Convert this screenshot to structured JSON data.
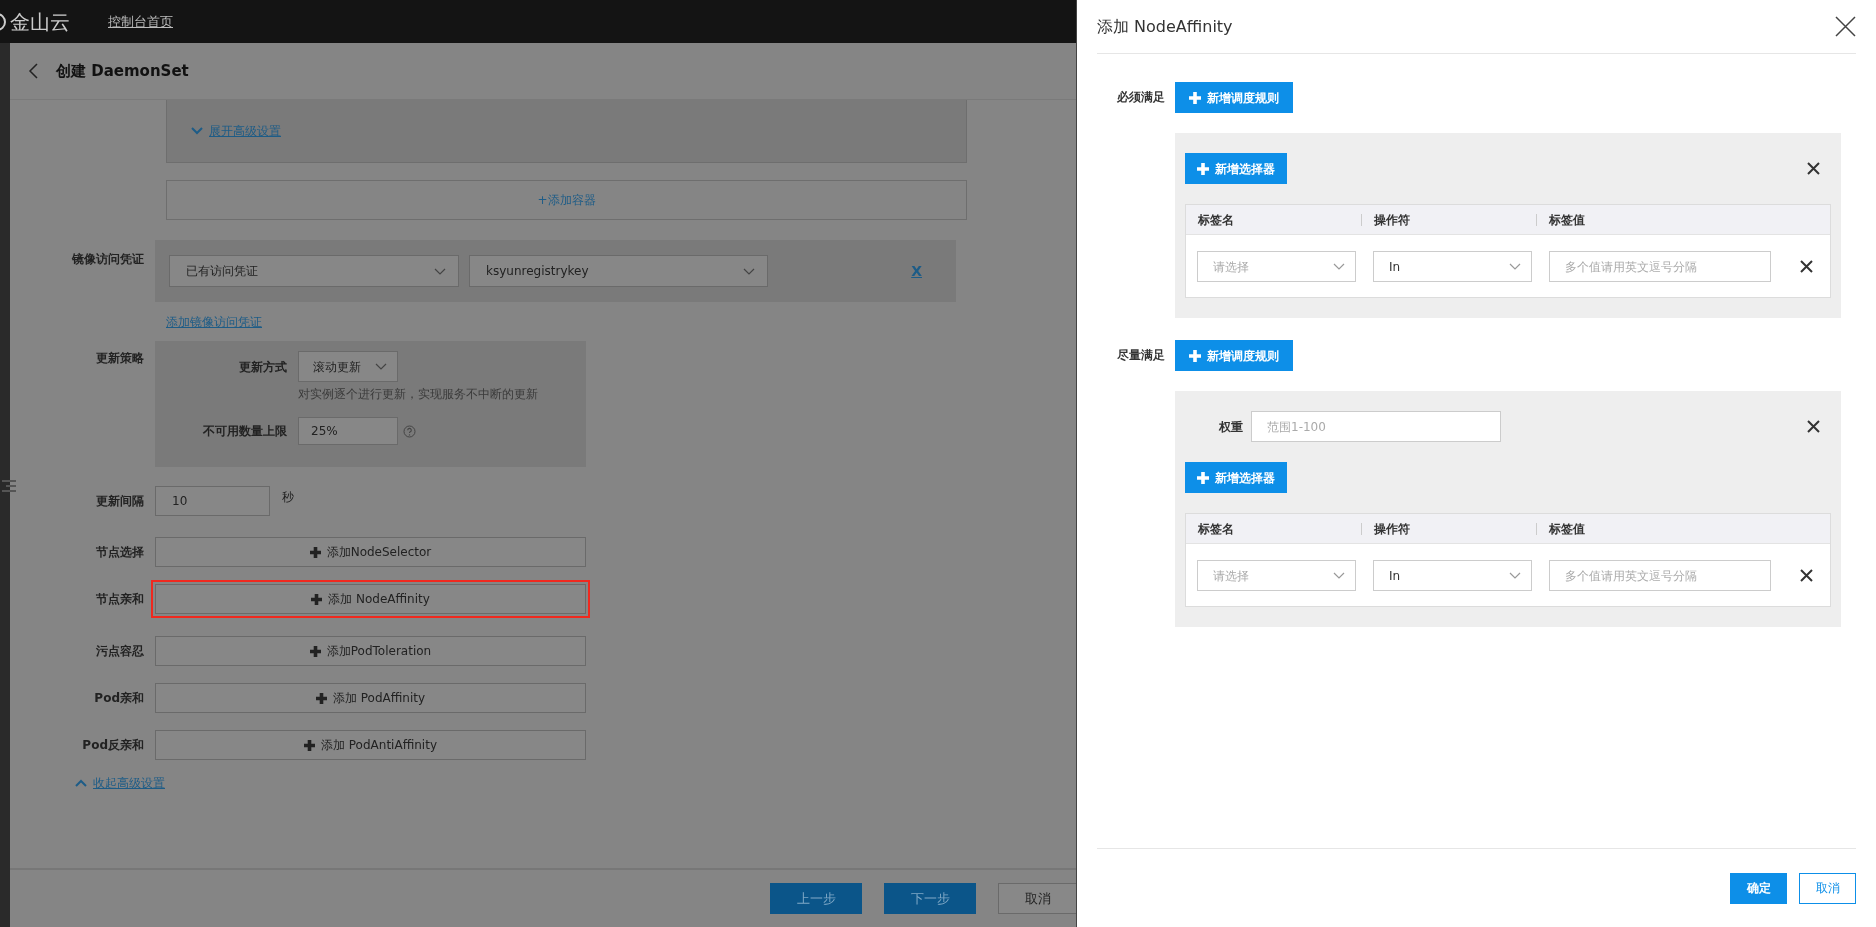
{
  "top_bar": {
    "logo": "金山云",
    "home_link": "控制台首页"
  },
  "page": {
    "title": "创建 DaemonSet",
    "expand_link": "展开高级设置",
    "add_container": "+添加容器",
    "registry": {
      "label": "镜像访问凭证",
      "selects": [
        {
          "value": "已有访问凭证"
        },
        {
          "value": "ksyunregistrykey"
        }
      ],
      "remove": "X",
      "add_link": "添加镜像访问凭证"
    },
    "update_strategy": {
      "label": "更新策略",
      "mode_label": "更新方式",
      "mode_value": "滚动更新",
      "mode_hint": "对实例逐个进行更新，实现服务不中断的更新",
      "max_label": "不可用数量上限",
      "max_value": "25%"
    },
    "interval": {
      "label": "更新间隔",
      "value": "10",
      "unit": "秒"
    },
    "scheduling": [
      {
        "label": "节点选择",
        "button": "添加NodeSelector",
        "highlighted": false
      },
      {
        "label": "节点亲和",
        "button": "添加 NodeAffinity",
        "highlighted": true
      },
      {
        "label": "污点容忍",
        "button": "添加PodToleration",
        "highlighted": false
      },
      {
        "label": "Pod亲和",
        "button": "添加 PodAffinity",
        "highlighted": false
      },
      {
        "label": "Pod反亲和",
        "button": "添加 PodAntiAffinity",
        "highlighted": false
      }
    ],
    "collapse_link": "收起高级设置",
    "footer": [
      {
        "label": "上一步",
        "kind": "primary"
      },
      {
        "label": "下一步",
        "kind": "primary"
      },
      {
        "label": "取消",
        "kind": "default"
      }
    ]
  },
  "drawer": {
    "title": "添加 NodeAffinity",
    "sections": [
      {
        "label": "必须满足",
        "add_rule": "新增调度规则",
        "rules": [
          {
            "add_selector": "新增选择器",
            "columns": [
              "标签名",
              "操作符",
              "标签值"
            ],
            "rows": [
              {
                "key_placeholder": "请选择",
                "operator": "In",
                "value_placeholder": "多个值请用英文逗号分隔"
              }
            ]
          }
        ]
      },
      {
        "label": "尽量满足",
        "add_rule": "新增调度规则",
        "rules": [
          {
            "weight_label": "权重",
            "weight_placeholder": "范围1-100",
            "add_selector": "新增选择器",
            "columns": [
              "标签名",
              "操作符",
              "标签值"
            ],
            "rows": [
              {
                "key_placeholder": "请选择",
                "operator": "In",
                "value_placeholder": "多个值请用英文逗号分隔"
              }
            ]
          }
        ]
      }
    ],
    "buttons": [
      {
        "label": "确定",
        "kind": "primary"
      },
      {
        "label": "取消",
        "kind": "default"
      }
    ]
  }
}
